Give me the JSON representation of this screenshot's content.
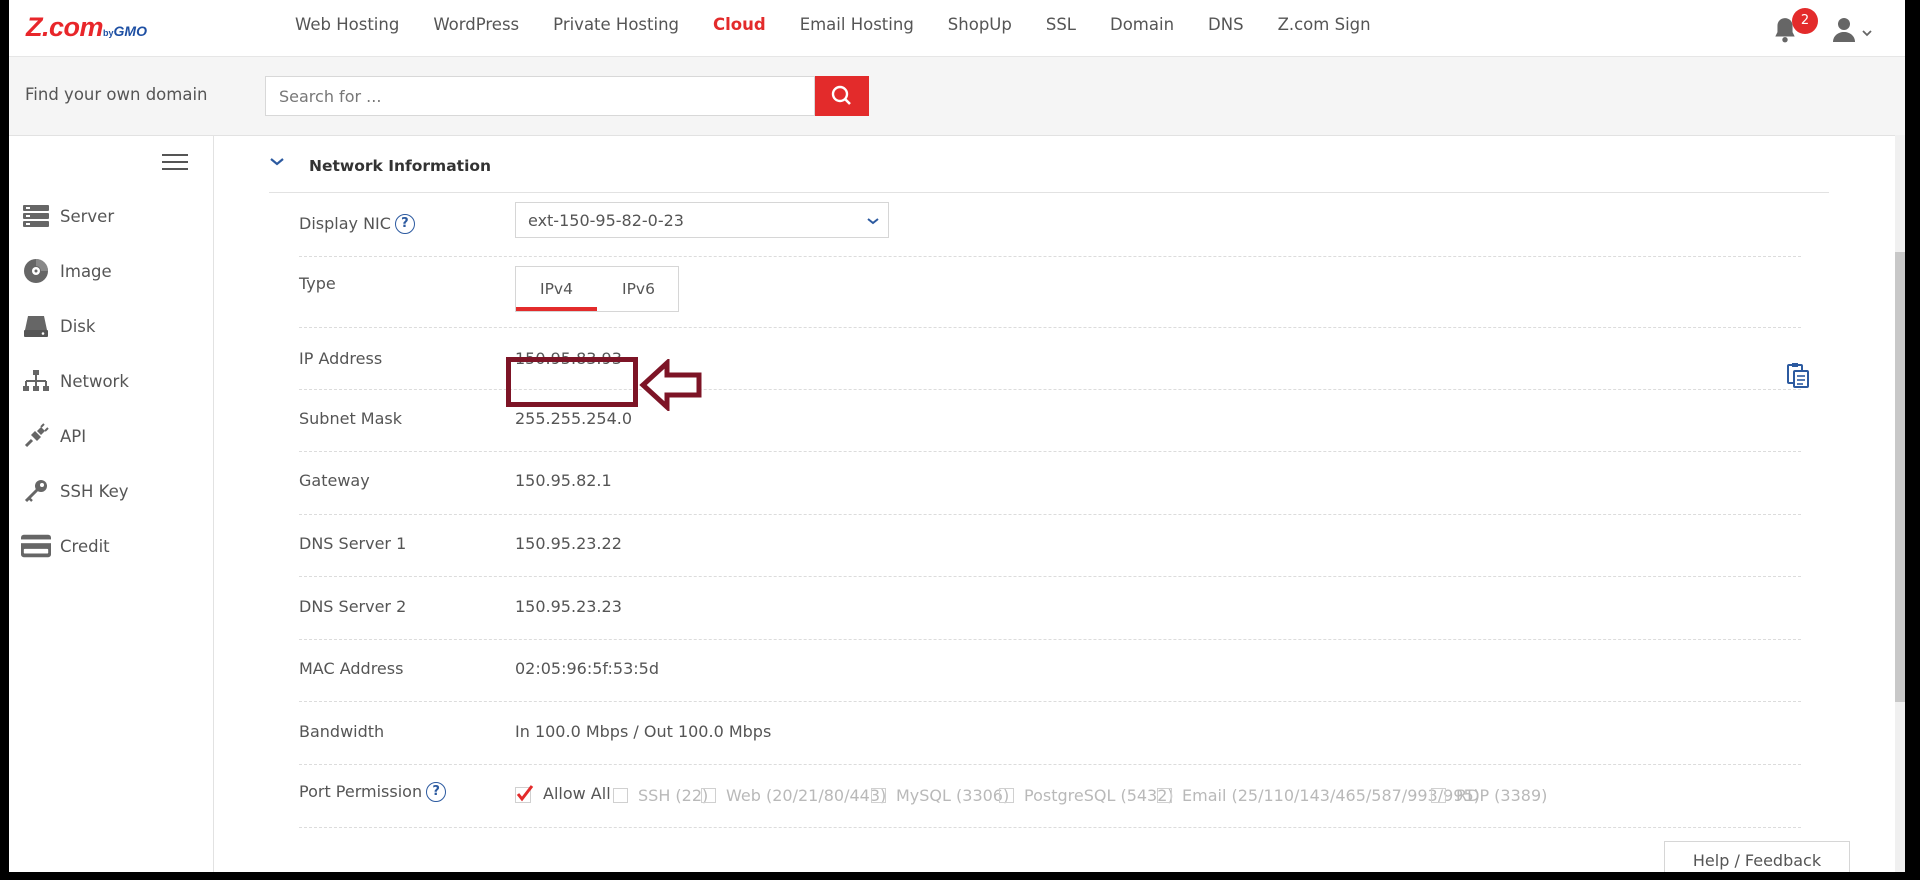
{
  "logo": {
    "mark": "Z.com",
    "by": "by",
    "brand": "GMO"
  },
  "nav": {
    "items": [
      "Web Hosting",
      "WordPress",
      "Private Hosting",
      "Cloud",
      "Email Hosting",
      "ShopUp",
      "SSL",
      "Domain",
      "DNS",
      "Z.com Sign"
    ],
    "active": "Cloud",
    "notification_count": "2"
  },
  "search": {
    "label": "Find your own domain",
    "placeholder": "Search for ..."
  },
  "sidebar": {
    "items": [
      {
        "label": "Server",
        "icon": "server-icon"
      },
      {
        "label": "Image",
        "icon": "image-icon"
      },
      {
        "label": "Disk",
        "icon": "disk-icon"
      },
      {
        "label": "Network",
        "icon": "network-icon"
      },
      {
        "label": "API",
        "icon": "api-icon"
      },
      {
        "label": "SSH Key",
        "icon": "key-icon"
      },
      {
        "label": "Credit",
        "icon": "credit-card-icon"
      }
    ]
  },
  "section": {
    "title": "Network Information"
  },
  "fields": {
    "display_nic": {
      "label": "Display NIC",
      "value": "ext-150-95-82-0-23"
    },
    "type": {
      "label": "Type",
      "tabs": [
        "IPv4",
        "IPv6"
      ],
      "active": "IPv4"
    },
    "ip_address": {
      "label": "IP Address",
      "value": "150.95.83.93"
    },
    "subnet_mask": {
      "label": "Subnet Mask",
      "value": "255.255.254.0"
    },
    "gateway": {
      "label": "Gateway",
      "value": "150.95.82.1"
    },
    "dns1": {
      "label": "DNS Server 1",
      "value": "150.95.23.22"
    },
    "dns2": {
      "label": "DNS Server 2",
      "value": "150.95.23.23"
    },
    "mac": {
      "label": "MAC Address",
      "value": "02:05:96:5f:53:5d"
    },
    "bandwidth": {
      "label": "Bandwidth",
      "value": "In 100.0 Mbps / Out 100.0 Mbps"
    },
    "port_permission": {
      "label": "Port Permission",
      "options": [
        {
          "label": "Allow All",
          "checked": true
        },
        {
          "label": "SSH (22)",
          "checked": false
        },
        {
          "label": "Web (20/21/80/443)",
          "checked": false
        },
        {
          "label": "MySQL (3306)",
          "checked": false
        },
        {
          "label": "PostgreSQL (5432)",
          "checked": false
        },
        {
          "label": "Email (25/110/143/465/587/993/995)",
          "checked": false
        },
        {
          "label": "RDP (3389)",
          "checked": false
        }
      ]
    }
  },
  "help": {
    "label": "Help / Feedback"
  },
  "colors": {
    "accent": "#e32b2b",
    "highlight": "#7d1426",
    "link": "#2c5aa0"
  }
}
